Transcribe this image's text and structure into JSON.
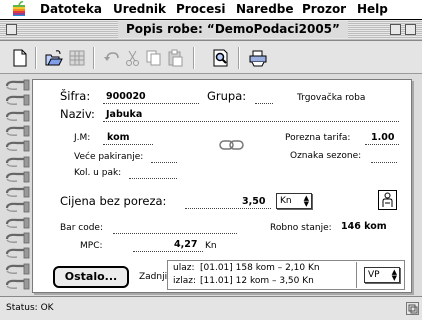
{
  "menu": [
    "Datoteka",
    "Urednik",
    "Procesi",
    "Naredbe",
    "Prozor",
    "Help"
  ],
  "window": {
    "title": "Popis robe: “DemoPodaci2005”"
  },
  "toolbar": {
    "icons": [
      "new-document-icon",
      "open-folder-icon",
      "grid-icon",
      "undo-icon",
      "cut-icon",
      "copy-icon",
      "paste-icon",
      "preview-icon",
      "print-icon"
    ]
  },
  "item": {
    "sifra_label": "Šifra:",
    "sifra": "900020",
    "grupa_label": "Grupa:",
    "grupa": "",
    "grupa_name": "Trgovačka roba",
    "naziv_label": "Naziv:",
    "naziv": "Jabuka",
    "jm_label": "J.M:",
    "jm": "kom",
    "porezna_label": "Porezna tarifa:",
    "porezna": "1.00",
    "vece_label": "Veće pakiranje:",
    "vece": "",
    "oznaka_label": "Oznaka sezone:",
    "oznaka": "",
    "kol_label": "Kol. u pak:",
    "kol": "",
    "cijena_label": "Cijena bez poreza:",
    "cijena": "3,50",
    "currency": "Kn",
    "barcode_label": "Bar code:",
    "barcode": "",
    "robno_label": "Robno stanje:",
    "robno": "146 kom",
    "mpc_label": "MPC:",
    "mpc": "4,27",
    "mpc_unit": "Kn"
  },
  "footer": {
    "ostalo_button": "Ostalo...",
    "zadnji_label": "Zadnji",
    "ulaz_label": "ulaz:",
    "ulaz": "[01.01] 158 kom – 2,10 Kn",
    "izlaz_label": "izlaz:",
    "izlaz": "[11.01] 12 kom – 3,50 Kn",
    "price_type": "VP"
  },
  "status": "Status: OK"
}
